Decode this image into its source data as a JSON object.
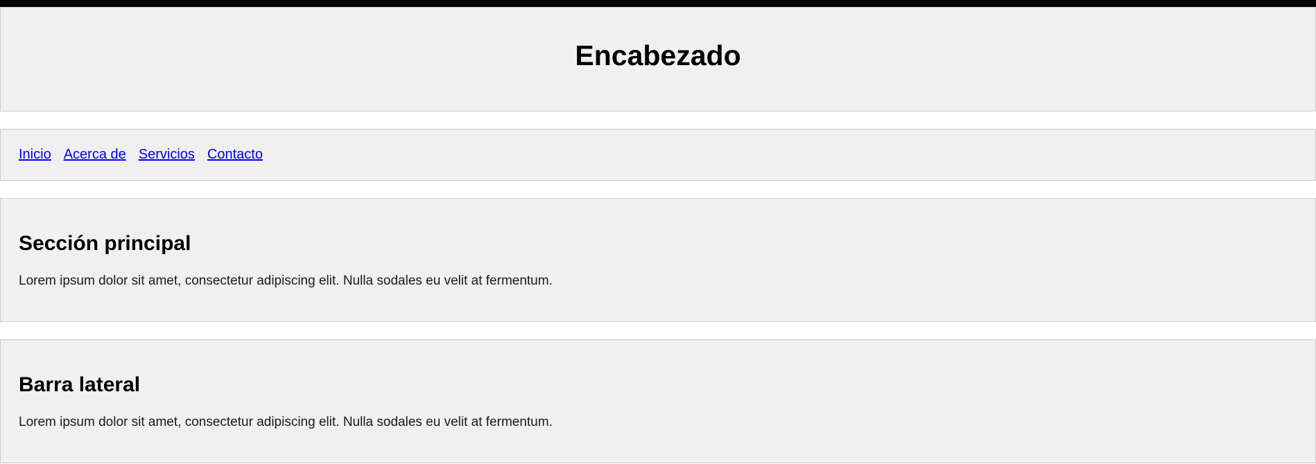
{
  "header": {
    "title": "Encabezado"
  },
  "nav": {
    "links": [
      {
        "label": "Inicio"
      },
      {
        "label": "Acerca de"
      },
      {
        "label": "Servicios"
      },
      {
        "label": "Contacto"
      }
    ]
  },
  "main": {
    "heading": "Sección principal",
    "text": "Lorem ipsum dolor sit amet, consectetur adipiscing elit. Nulla sodales eu velit at fermentum."
  },
  "sidebar": {
    "heading": "Barra lateral",
    "text": "Lorem ipsum dolor sit amet, consectetur adipiscing elit. Nulla sodales eu velit at fermentum."
  },
  "colors": {
    "panel_background": "#f0f0f0",
    "panel_border": "#cccccc",
    "link": "#0000ee",
    "top_bar": "#000000"
  }
}
